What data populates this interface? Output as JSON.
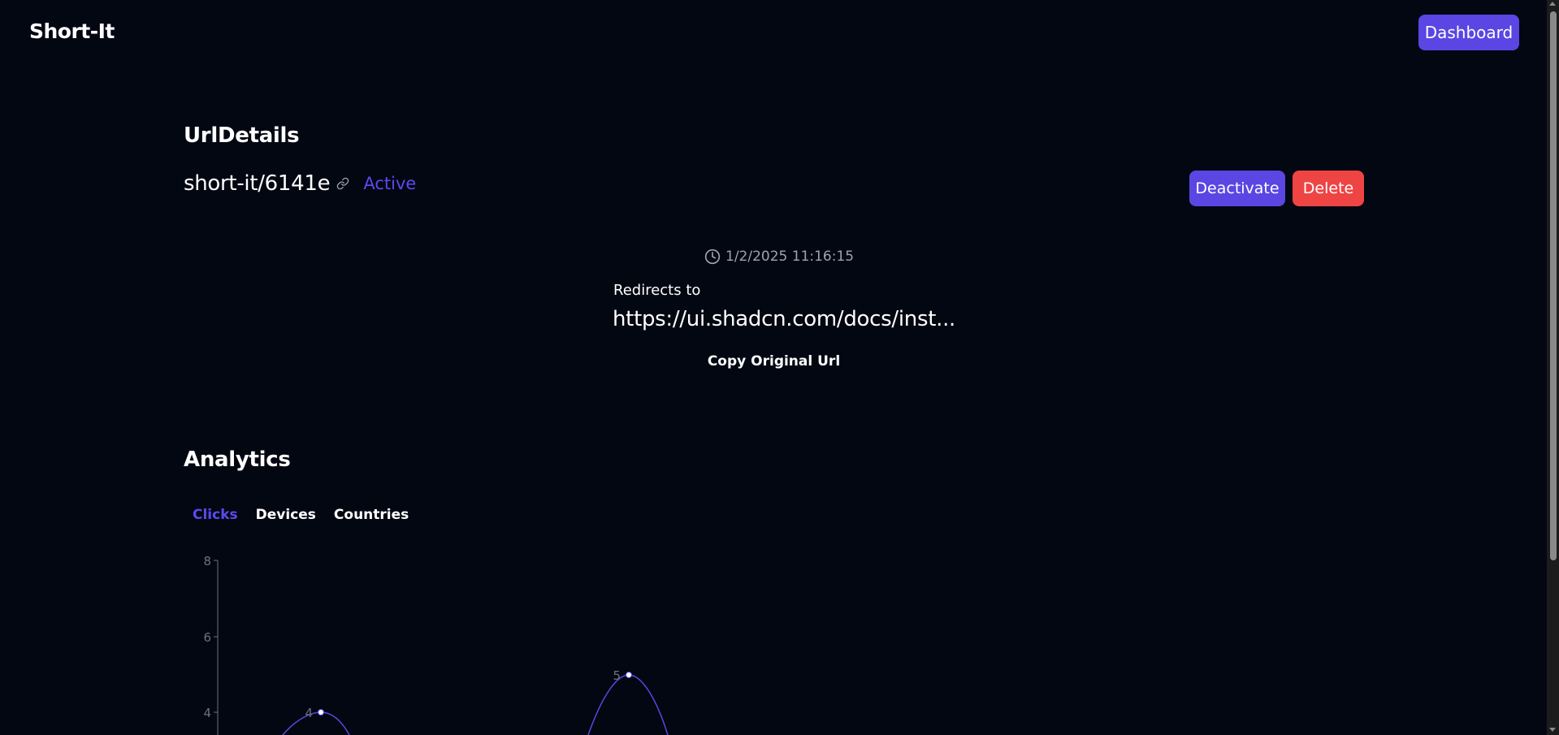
{
  "header": {
    "brand": "Short-It",
    "dashboard_label": "Dashboard"
  },
  "details": {
    "title": "UrlDetails",
    "short_url": "short-it/6141e",
    "status": "Active",
    "deactivate_label": "Deactivate",
    "delete_label": "Delete",
    "created_at": "1/2/2025 11:16:15",
    "redirects_label": "Redirects to",
    "original_url": "https://ui.shadcn.com/docs/inst...",
    "copy_label": "Copy Original Url"
  },
  "analytics": {
    "title": "Analytics",
    "tabs": [
      {
        "label": "Clicks",
        "active": true
      },
      {
        "label": "Devices",
        "active": false
      },
      {
        "label": "Countries",
        "active": false
      }
    ]
  },
  "colors": {
    "background": "#030712",
    "accent": "#5b46e3",
    "danger": "#ef4444",
    "muted": "#9ca3af"
  },
  "icons": [
    "link-icon",
    "clock-icon"
  ],
  "chart_data": {
    "type": "line",
    "y_ticks": [
      "8",
      "6",
      "4"
    ],
    "ylim": [
      0,
      8
    ],
    "points": [
      {
        "index": 1,
        "y": 4,
        "label": "4"
      },
      {
        "index": 2,
        "y": 5,
        "label": "5"
      }
    ],
    "line_color": "#5b46e3",
    "note": "chart is cropped at the bottom of the viewport"
  }
}
